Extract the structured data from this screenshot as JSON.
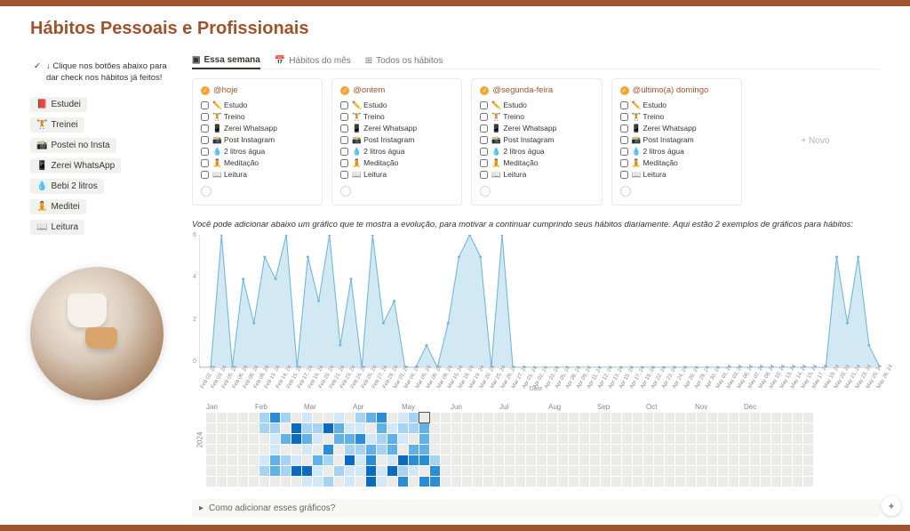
{
  "page_title": "Hábitos Pessoais e Profissionais",
  "callout": {
    "icon": "✓",
    "text": "↓ Clique nos botões abaixo para dar check nos hábitos já feitos!"
  },
  "side_buttons": [
    {
      "emoji": "📕",
      "label": "Estudei"
    },
    {
      "emoji": "🏋️",
      "label": "Treinei"
    },
    {
      "emoji": "📸",
      "label": "Postei no Insta"
    },
    {
      "emoji": "📱",
      "label": "Zerei WhatsApp"
    },
    {
      "emoji": "💧",
      "label": "Bebi 2 litros"
    },
    {
      "emoji": "🧘",
      "label": "Meditei"
    },
    {
      "emoji": "📖",
      "label": "Leitura"
    }
  ],
  "tabs": [
    {
      "icon": "▣",
      "label": "Essa semana",
      "active": true
    },
    {
      "icon": "📅",
      "label": "Hábitos do mês",
      "active": false
    },
    {
      "icon": "⊞",
      "label": "Todos os hábitos",
      "active": false
    }
  ],
  "days": [
    {
      "title": "@hoje"
    },
    {
      "title": "@ontem"
    },
    {
      "title": "@segunda-feira"
    },
    {
      "title": "@último(a) domingo"
    }
  ],
  "day_tasks": [
    {
      "emoji": "✏️",
      "label": "Estudo"
    },
    {
      "emoji": "🏋️",
      "label": "Treino"
    },
    {
      "emoji": "📱",
      "label": "Zerei Whatsapp"
    },
    {
      "emoji": "📸",
      "label": "Post Instagram"
    },
    {
      "emoji": "💧",
      "label": "2 litros água"
    },
    {
      "emoji": "🧘",
      "label": "Meditação"
    },
    {
      "emoji": "📖",
      "label": "Leitura"
    }
  ],
  "new_label": "+ Novo",
  "note_text": "Você pode adicionar abaixo um gráfico que te mostra a evolução, para motivar a continuar cumprindo seus hábitos diariamente. Aqui estão 2 exemplos de gráficos para hábitos:",
  "toggle_text": "Como adicionar esses gráficos?",
  "date_axis_label": "Date",
  "heat_year": "2024",
  "heat_months": [
    "Jan",
    "Feb",
    "Mar",
    "Apr",
    "May",
    "Jun",
    "Jul",
    "Aug",
    "Sep",
    "Oct",
    "Nov",
    "Dec"
  ],
  "chart_data": {
    "type": "line",
    "title": "",
    "xlabel": "Date",
    "ylabel": "",
    "ylim": [
      0,
      6
    ],
    "yticks": [
      0,
      2,
      4,
      6
    ],
    "x": [
      "Feb 02, 24",
      "Feb 03, 24",
      "Feb 05, 24",
      "Feb 06, 24",
      "Feb 08, 24",
      "Feb 09, 24",
      "Feb 13, 24",
      "Feb 14, 24",
      "Feb 15, 24",
      "Feb 17, 24",
      "Feb 19, 24",
      "Feb 20, 24",
      "Feb 21, 24",
      "Feb 23, 24",
      "Feb 24, 24",
      "Feb 26, 24",
      "Feb 27, 24",
      "Feb 28, 24",
      "Mar 01, 24",
      "Mar 04, 24",
      "Mar 05, 24",
      "Mar 06, 24",
      "Mar 08, 24",
      "Mar 15, 24",
      "Mar 18, 24",
      "Mar 19, 24",
      "Mar 20, 24",
      "Mar 25, 24",
      "Mar 26, 24",
      "Mar 27, 24",
      "Apr 01, 24",
      "Apr 02, 24",
      "Apr 03, 24",
      "Apr 05, 24",
      "Apr 08, 24",
      "Apr 09, 24",
      "Apr 11, 24",
      "Apr 12, 24",
      "Apr 13, 24",
      "Apr 15, 24",
      "Apr 17, 24",
      "Apr 19, 24",
      "Apr 22, 24",
      "Apr 23, 24",
      "Apr 24, 24",
      "Apr 26, 24",
      "Apr 29, 24",
      "Apr 30, 24",
      "May 01, 24",
      "May 03, 24",
      "May 06, 24",
      "May 07, 24",
      "May 08, 24",
      "May 10, 24",
      "May 13, 24",
      "May 14, 24",
      "May 15, 24",
      "May 17, 24",
      "May 19, 24",
      "May 20, 24",
      "May 21, 24",
      "May 23, 24",
      "May 25, 24",
      "May 26, 24"
    ],
    "values": [
      0,
      0,
      6,
      0,
      4,
      2,
      5,
      4,
      6,
      0,
      5,
      3,
      6,
      1,
      4,
      0,
      6,
      2,
      3,
      0,
      0,
      1,
      0,
      2,
      5,
      6,
      5,
      0,
      6,
      0,
      0,
      0,
      0,
      0,
      0,
      0,
      0,
      0,
      0,
      0,
      0,
      0,
      0,
      0,
      0,
      0,
      0,
      0,
      0,
      0,
      0,
      0,
      0,
      0,
      0,
      0,
      0,
      0,
      0,
      5,
      2,
      5,
      1,
      0
    ]
  },
  "heatmap_data": {
    "type": "heatmap",
    "year": "2024",
    "columns": 53,
    "rows": 7,
    "colors": {
      "0": "#ebebe9",
      "1": "#d2e7f7",
      "2": "#a7d3f2",
      "3": "#5fb1e6",
      "4": "#2a8ed6",
      "5": "#0a6bc0"
    },
    "values_note": "intensity 0-5 per day; weeks ~5-21 contain activity, rest 0"
  }
}
